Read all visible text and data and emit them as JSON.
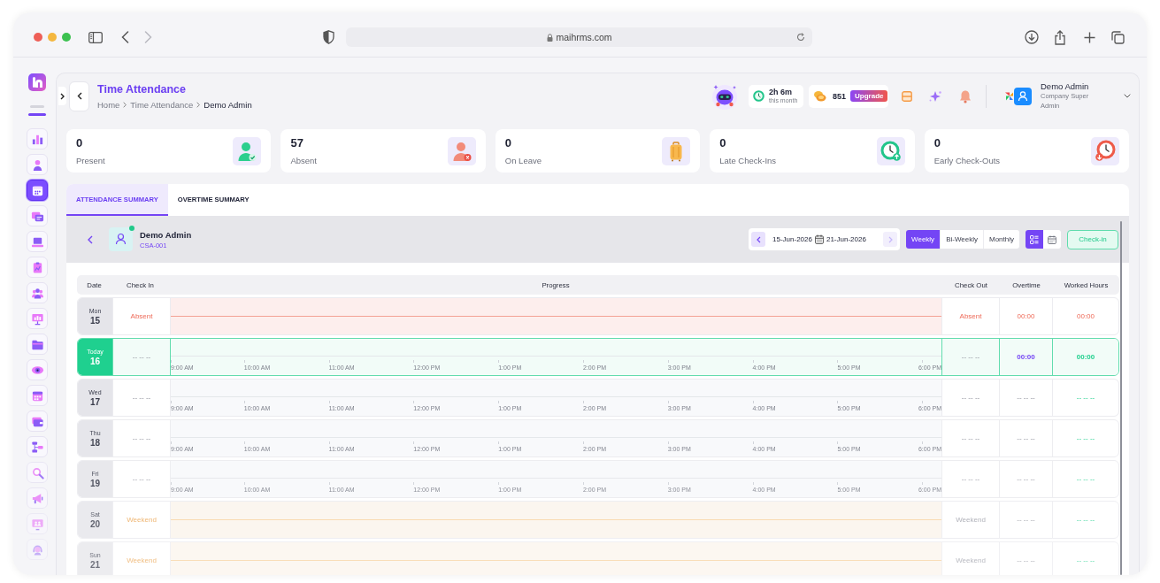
{
  "browser": {
    "url": "maihrms.com"
  },
  "sidebar": {
    "items": [
      {
        "selected": false
      },
      {
        "selected": false
      },
      {
        "selected": true
      },
      {
        "selected": false
      },
      {
        "selected": false
      },
      {
        "selected": false
      },
      {
        "selected": false
      },
      {
        "selected": false
      },
      {
        "selected": false
      },
      {
        "selected": false
      },
      {
        "selected": false
      },
      {
        "selected": false
      },
      {
        "selected": false
      },
      {
        "selected": false
      },
      {
        "selected": false
      },
      {
        "selected": false
      },
      {
        "selected": false
      }
    ]
  },
  "header": {
    "title": "Time Attendance",
    "breadcrumb": [
      {
        "label": "Home",
        "current": false
      },
      {
        "label": "Time Attendance",
        "current": false
      },
      {
        "label": "Demo Admin",
        "current": true
      }
    ],
    "usage": {
      "value": "2h 6m",
      "caption": "this month"
    },
    "coins": {
      "value": "851",
      "action": "Upgrade"
    },
    "user": {
      "name": "Demo Admin",
      "role": "Company Super Admin"
    }
  },
  "stats": [
    {
      "kind": "present",
      "value": "0",
      "label": "Present"
    },
    {
      "kind": "absent",
      "value": "57",
      "label": "Absent"
    },
    {
      "kind": "leave",
      "value": "0",
      "label": "On Leave"
    },
    {
      "kind": "late",
      "value": "0",
      "label": "Late Check-Ins"
    },
    {
      "kind": "early",
      "value": "0",
      "label": "Early Check-Outs"
    }
  ],
  "tabs": [
    {
      "label": "ATTENDANCE SUMMARY",
      "selected": true
    },
    {
      "label": "OVERTIME SUMMARY",
      "selected": false
    }
  ],
  "employee": {
    "name": "Demo Admin",
    "code": "CSA-001",
    "online": true
  },
  "date_range": {
    "start": "15-Jun-2026",
    "end": "21-Jun-2026"
  },
  "periods": [
    {
      "label": "Weekly",
      "selected": true
    },
    {
      "label": "Bi-Weekly",
      "selected": false
    },
    {
      "label": "Monthly",
      "selected": false
    }
  ],
  "views": [
    {
      "kind": "list",
      "selected": true
    },
    {
      "kind": "calendar",
      "selected": false
    }
  ],
  "check_in_button": "Check-in",
  "table": {
    "columns": [
      "Date",
      "Check In",
      "Progress",
      "Check Out",
      "Overtime",
      "Worked Hours"
    ],
    "rows": [
      {
        "kind": "absent",
        "day": "Mon",
        "date": "15",
        "today": false,
        "check_in": "Absent",
        "check_out": "Absent",
        "overtime": "00:00",
        "worked_hours": "00:00"
      },
      {
        "kind": "timeline",
        "day": "Today",
        "date": "16",
        "today": true,
        "check_in": "-- -- --",
        "ticks": [
          "9:00 AM",
          "10:00 AM",
          "11:00 AM",
          "12:00 PM",
          "1:00 PM",
          "2:00 PM",
          "3:00 PM",
          "4:00 PM",
          "5:00 PM",
          "6:00 PM"
        ],
        "check_out": "-- -- --",
        "overtime": "00:00",
        "worked_hours": "00:00"
      },
      {
        "kind": "timeline",
        "day": "Wed",
        "date": "17",
        "today": false,
        "check_in": "-- -- --",
        "ticks": [
          "9:00 AM",
          "10:00 AM",
          "11:00 AM",
          "12:00 PM",
          "1:00 PM",
          "2:00 PM",
          "3:00 PM",
          "4:00 PM",
          "5:00 PM",
          "6:00 PM"
        ],
        "check_out": "-- -- --",
        "overtime": "-- -- --",
        "worked_hours": "-- -- --"
      },
      {
        "kind": "timeline",
        "day": "Thu",
        "date": "18",
        "today": false,
        "check_in": "-- -- --",
        "ticks": [
          "9:00 AM",
          "10:00 AM",
          "11:00 AM",
          "12:00 PM",
          "1:00 PM",
          "2:00 PM",
          "3:00 PM",
          "4:00 PM",
          "5:00 PM",
          "6:00 PM"
        ],
        "check_out": "-- -- --",
        "overtime": "-- -- --",
        "worked_hours": "-- -- --"
      },
      {
        "kind": "timeline",
        "day": "Fri",
        "date": "19",
        "today": false,
        "check_in": "-- -- --",
        "ticks": [
          "9:00 AM",
          "10:00 AM",
          "11:00 AM",
          "12:00 PM",
          "1:00 PM",
          "2:00 PM",
          "3:00 PM",
          "4:00 PM",
          "5:00 PM",
          "6:00 PM"
        ],
        "check_out": "-- -- --",
        "overtime": "-- -- --",
        "worked_hours": "-- -- --"
      },
      {
        "kind": "weekend",
        "day": "Sat",
        "date": "20",
        "today": false,
        "check_in": "Weekend",
        "check_out": "Weekend",
        "overtime": "-- -- --",
        "worked_hours": "-- -- --"
      },
      {
        "kind": "weekend",
        "day": "Sun",
        "date": "21",
        "today": false,
        "check_in": "Weekend",
        "check_out": "Weekend",
        "overtime": "-- -- --",
        "worked_hours": "-- -- --"
      }
    ]
  }
}
